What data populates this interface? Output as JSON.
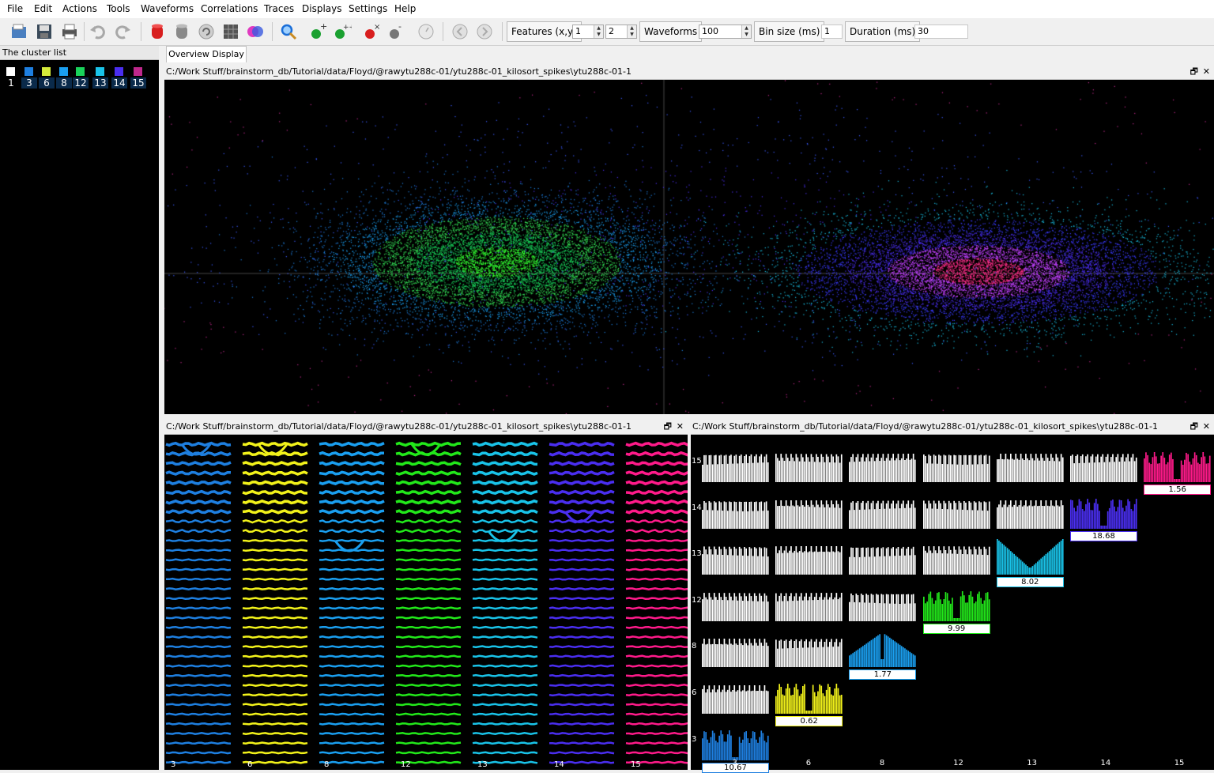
{
  "menu": [
    "File",
    "Edit",
    "Actions",
    "Tools",
    "Waveforms",
    "Correlations",
    "Traces",
    "Displays",
    "Settings",
    "Help"
  ],
  "toolbar": {
    "features_label": "Features (x,y)",
    "feature_x": "1",
    "feature_y": "2",
    "waveforms_label": "Waveforms",
    "waveforms_value": "100",
    "bin_label": "Bin size (ms)",
    "bin_value": "1",
    "duration_label": "Duration (ms)",
    "duration_value": "30"
  },
  "cluster_list": {
    "title": "The cluster list",
    "items": [
      {
        "id": "1",
        "color": "#ffffff"
      },
      {
        "id": "3",
        "color": "#1e7fe0"
      },
      {
        "id": "6",
        "color": "#d4ea3a"
      },
      {
        "id": "8",
        "color": "#1a9ff0"
      },
      {
        "id": "12",
        "color": "#19d25a"
      },
      {
        "id": "13",
        "color": "#19c3e8"
      },
      {
        "id": "14",
        "color": "#4a2ef0"
      },
      {
        "id": "15",
        "color": "#c0288c"
      }
    ]
  },
  "tabs": [
    "Overview Display"
  ],
  "feature_panel": {
    "title": "C:/Work Stuff/brainstorm_db/Tutorial/data/Floyd/@rawytu288c-01/ytu288c-01_kilosort_spikes\\ytu288c-01-1"
  },
  "waveform_panel": {
    "title": "C:/Work Stuff/brainstorm_db/Tutorial/data/Floyd/@rawytu288c-01/ytu288c-01_kilosort_spikes\\ytu288c-01-1",
    "clusters": [
      {
        "id": "3",
        "color": "#1e7fe0"
      },
      {
        "id": "6",
        "color": "#f2f21a"
      },
      {
        "id": "8",
        "color": "#1a9ff0"
      },
      {
        "id": "12",
        "color": "#22e81a"
      },
      {
        "id": "13",
        "color": "#19c3e8"
      },
      {
        "id": "14",
        "color": "#4a2ef0"
      },
      {
        "id": "15",
        "color": "#ff1a8a"
      }
    ]
  },
  "correlogram_panel": {
    "title": "C:/Work Stuff/brainstorm_db/Tutorial/data/Floyd/@rawytu288c-01/ytu288c-01_kilosort_spikes\\ytu288c-01-1",
    "row_labels": [
      "15",
      "14",
      "13",
      "12",
      "8",
      "6",
      "3"
    ],
    "col_labels": [
      "3",
      "6",
      "8",
      "12",
      "13",
      "14",
      "15"
    ],
    "diag": [
      {
        "cluster": "15",
        "color": "#ff1a8a",
        "value": "1.56"
      },
      {
        "cluster": "14",
        "color": "#4a2ef0",
        "value": "18.68"
      },
      {
        "cluster": "13",
        "color": "#19c3e8",
        "value": "8.02"
      },
      {
        "cluster": "12",
        "color": "#22e81a",
        "value": "9.99"
      },
      {
        "cluster": "8",
        "color": "#1a9ff0",
        "value": "1.77"
      },
      {
        "cluster": "6",
        "color": "#f2f21a",
        "value": "0.62"
      },
      {
        "cluster": "3",
        "color": "#1e7fe0",
        "value": "10.67"
      }
    ]
  },
  "window_controls": {
    "restore": "🗗",
    "close": "✕"
  }
}
